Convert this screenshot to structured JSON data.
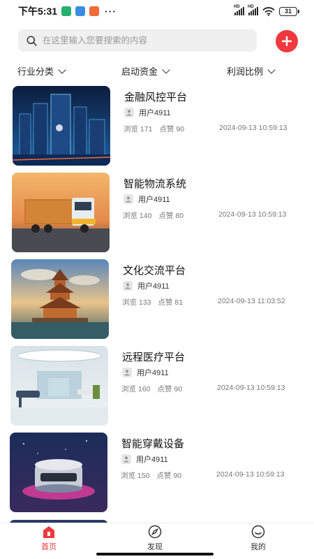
{
  "status_bar": {
    "time": "下午5:31",
    "battery": "31",
    "more": "···",
    "signal_label": "HD"
  },
  "search": {
    "placeholder": "在这里输入您要搜索的内容"
  },
  "filters": [
    {
      "label": "行业分类"
    },
    {
      "label": "启动资金"
    },
    {
      "label": "利润比例"
    }
  ],
  "items": [
    {
      "title": "金融风控平台",
      "user": "用户4911",
      "views_label": "浏览 171",
      "likes_label": "点赞 90",
      "time": "2024-09-13 10:59:13",
      "image": "city-tower-image"
    },
    {
      "title": "智能物流系统",
      "user": "用户4911",
      "views_label": "浏览 140",
      "likes_label": "点赞 80",
      "time": "2024-09-13 10:59:13",
      "image": "truck-image"
    },
    {
      "title": "文化交流平台",
      "user": "用户4911",
      "views_label": "浏览 133",
      "likes_label": "点赞 81",
      "time": "2024-09-13 11:03:52",
      "image": "pagoda-image"
    },
    {
      "title": "远程医疗平台",
      "user": "用户4911",
      "views_label": "浏览 160",
      "likes_label": "点赞 90",
      "time": "2024-09-13 10:59:13",
      "image": "clinic-room-image"
    },
    {
      "title": "智能穿戴设备",
      "user": "用户4911",
      "views_label": "浏览 150",
      "likes_label": "点赞 90",
      "time": "2024-09-13 10:59:13",
      "image": "device-image"
    }
  ],
  "tabs": [
    {
      "label": "首页",
      "icon": "home-icon",
      "active": true
    },
    {
      "label": "发现",
      "icon": "compass-icon",
      "active": false
    },
    {
      "label": "我的",
      "icon": "smile-icon",
      "active": false
    }
  ],
  "colors": {
    "accent": "#f0383f",
    "active_tab": "#e8333a",
    "search_bg": "#f0f0f0"
  }
}
